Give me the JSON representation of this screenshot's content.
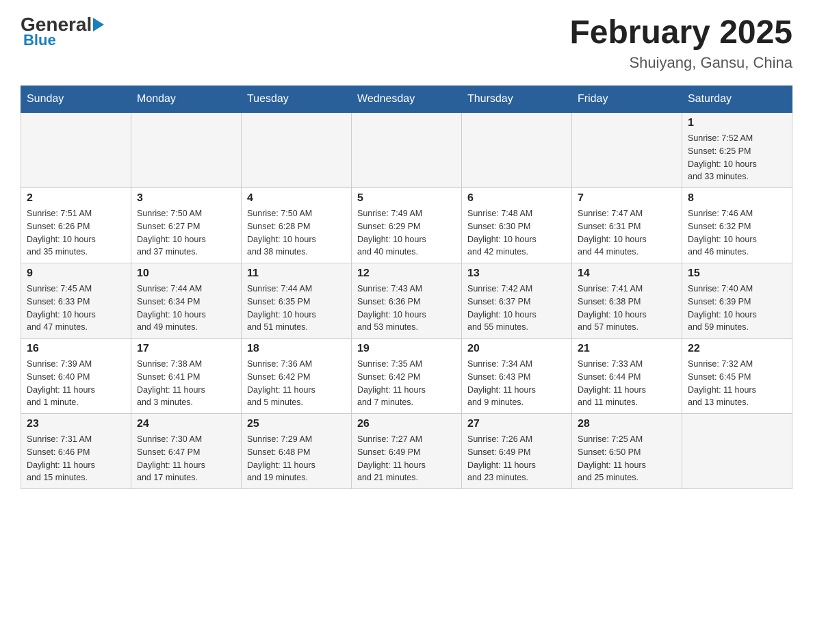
{
  "header": {
    "logo_general": "General",
    "logo_blue": "Blue",
    "title": "February 2025",
    "subtitle": "Shuiyang, Gansu, China"
  },
  "weekdays": [
    "Sunday",
    "Monday",
    "Tuesday",
    "Wednesday",
    "Thursday",
    "Friday",
    "Saturday"
  ],
  "weeks": [
    {
      "days": [
        {
          "num": "",
          "info": ""
        },
        {
          "num": "",
          "info": ""
        },
        {
          "num": "",
          "info": ""
        },
        {
          "num": "",
          "info": ""
        },
        {
          "num": "",
          "info": ""
        },
        {
          "num": "",
          "info": ""
        },
        {
          "num": "1",
          "info": "Sunrise: 7:52 AM\nSunset: 6:25 PM\nDaylight: 10 hours\nand 33 minutes."
        }
      ]
    },
    {
      "days": [
        {
          "num": "2",
          "info": "Sunrise: 7:51 AM\nSunset: 6:26 PM\nDaylight: 10 hours\nand 35 minutes."
        },
        {
          "num": "3",
          "info": "Sunrise: 7:50 AM\nSunset: 6:27 PM\nDaylight: 10 hours\nand 37 minutes."
        },
        {
          "num": "4",
          "info": "Sunrise: 7:50 AM\nSunset: 6:28 PM\nDaylight: 10 hours\nand 38 minutes."
        },
        {
          "num": "5",
          "info": "Sunrise: 7:49 AM\nSunset: 6:29 PM\nDaylight: 10 hours\nand 40 minutes."
        },
        {
          "num": "6",
          "info": "Sunrise: 7:48 AM\nSunset: 6:30 PM\nDaylight: 10 hours\nand 42 minutes."
        },
        {
          "num": "7",
          "info": "Sunrise: 7:47 AM\nSunset: 6:31 PM\nDaylight: 10 hours\nand 44 minutes."
        },
        {
          "num": "8",
          "info": "Sunrise: 7:46 AM\nSunset: 6:32 PM\nDaylight: 10 hours\nand 46 minutes."
        }
      ]
    },
    {
      "days": [
        {
          "num": "9",
          "info": "Sunrise: 7:45 AM\nSunset: 6:33 PM\nDaylight: 10 hours\nand 47 minutes."
        },
        {
          "num": "10",
          "info": "Sunrise: 7:44 AM\nSunset: 6:34 PM\nDaylight: 10 hours\nand 49 minutes."
        },
        {
          "num": "11",
          "info": "Sunrise: 7:44 AM\nSunset: 6:35 PM\nDaylight: 10 hours\nand 51 minutes."
        },
        {
          "num": "12",
          "info": "Sunrise: 7:43 AM\nSunset: 6:36 PM\nDaylight: 10 hours\nand 53 minutes."
        },
        {
          "num": "13",
          "info": "Sunrise: 7:42 AM\nSunset: 6:37 PM\nDaylight: 10 hours\nand 55 minutes."
        },
        {
          "num": "14",
          "info": "Sunrise: 7:41 AM\nSunset: 6:38 PM\nDaylight: 10 hours\nand 57 minutes."
        },
        {
          "num": "15",
          "info": "Sunrise: 7:40 AM\nSunset: 6:39 PM\nDaylight: 10 hours\nand 59 minutes."
        }
      ]
    },
    {
      "days": [
        {
          "num": "16",
          "info": "Sunrise: 7:39 AM\nSunset: 6:40 PM\nDaylight: 11 hours\nand 1 minute."
        },
        {
          "num": "17",
          "info": "Sunrise: 7:38 AM\nSunset: 6:41 PM\nDaylight: 11 hours\nand 3 minutes."
        },
        {
          "num": "18",
          "info": "Sunrise: 7:36 AM\nSunset: 6:42 PM\nDaylight: 11 hours\nand 5 minutes."
        },
        {
          "num": "19",
          "info": "Sunrise: 7:35 AM\nSunset: 6:42 PM\nDaylight: 11 hours\nand 7 minutes."
        },
        {
          "num": "20",
          "info": "Sunrise: 7:34 AM\nSunset: 6:43 PM\nDaylight: 11 hours\nand 9 minutes."
        },
        {
          "num": "21",
          "info": "Sunrise: 7:33 AM\nSunset: 6:44 PM\nDaylight: 11 hours\nand 11 minutes."
        },
        {
          "num": "22",
          "info": "Sunrise: 7:32 AM\nSunset: 6:45 PM\nDaylight: 11 hours\nand 13 minutes."
        }
      ]
    },
    {
      "days": [
        {
          "num": "23",
          "info": "Sunrise: 7:31 AM\nSunset: 6:46 PM\nDaylight: 11 hours\nand 15 minutes."
        },
        {
          "num": "24",
          "info": "Sunrise: 7:30 AM\nSunset: 6:47 PM\nDaylight: 11 hours\nand 17 minutes."
        },
        {
          "num": "25",
          "info": "Sunrise: 7:29 AM\nSunset: 6:48 PM\nDaylight: 11 hours\nand 19 minutes."
        },
        {
          "num": "26",
          "info": "Sunrise: 7:27 AM\nSunset: 6:49 PM\nDaylight: 11 hours\nand 21 minutes."
        },
        {
          "num": "27",
          "info": "Sunrise: 7:26 AM\nSunset: 6:49 PM\nDaylight: 11 hours\nand 23 minutes."
        },
        {
          "num": "28",
          "info": "Sunrise: 7:25 AM\nSunset: 6:50 PM\nDaylight: 11 hours\nand 25 minutes."
        },
        {
          "num": "",
          "info": ""
        }
      ]
    }
  ]
}
